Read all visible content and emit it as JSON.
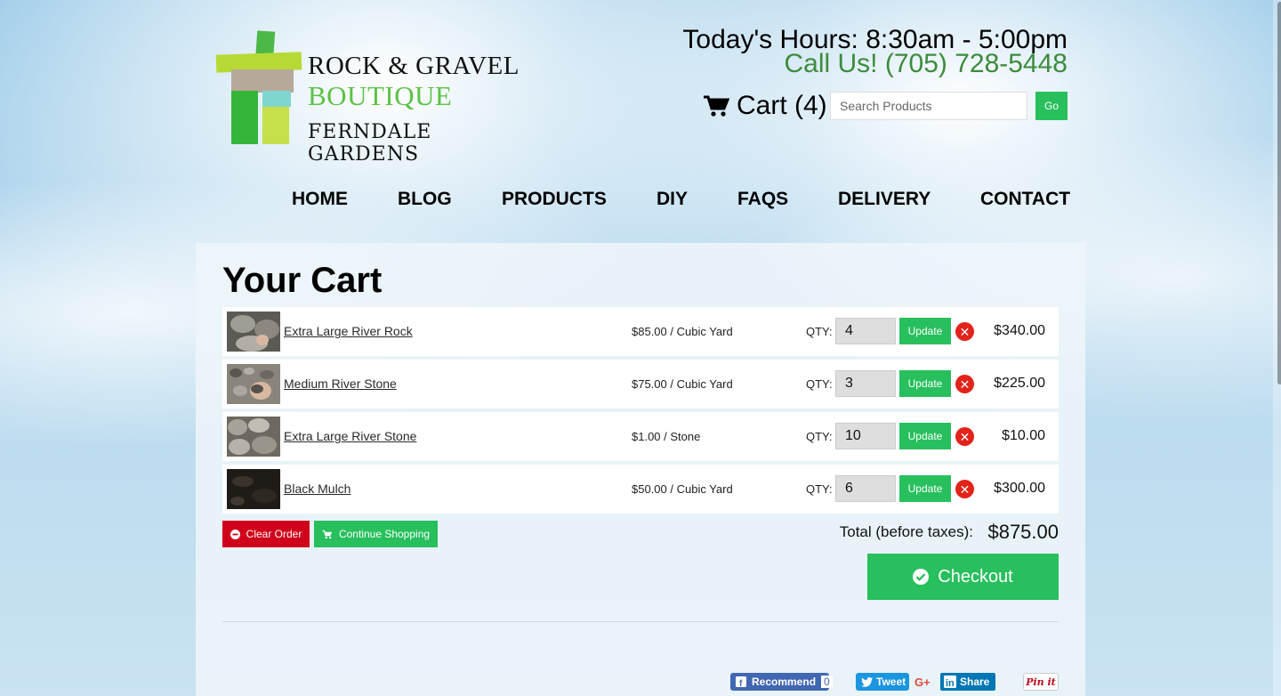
{
  "header": {
    "logo": {
      "line1": "ROCK & GRAVEL",
      "line2": "BOUTIQUE",
      "line3": "FERNDALE GARDENS"
    },
    "hours": "Today's Hours: 8:30am - 5:00pm",
    "phone": "Call Us! (705) 728-5448",
    "cart_label": "Cart (4)",
    "search_placeholder": "Search Products",
    "search_button": "Go"
  },
  "nav": [
    "HOME",
    "BLOG",
    "PRODUCTS",
    "DIY",
    "FAQS",
    "DELIVERY",
    "CONTACT"
  ],
  "cart": {
    "title": "Your Cart",
    "qty_label": "QTY:",
    "update_label": "Update",
    "items": [
      {
        "name": "Extra Large River Rock",
        "price": "$85.00 / Cubic Yard",
        "qty": "4",
        "total": "$340.00",
        "thumb_color": "#7d7a72"
      },
      {
        "name": "Medium River Stone",
        "price": "$75.00 / Cubic Yard",
        "qty": "3",
        "total": "$225.00",
        "thumb_color": "#6e6a62"
      },
      {
        "name": "Extra Large River Stone",
        "price": "$1.00 / Stone",
        "qty": "10",
        "total": "$10.00",
        "thumb_color": "#8b877f"
      },
      {
        "name": "Black Mulch",
        "price": "$50.00 / Cubic Yard",
        "qty": "6",
        "total": "$300.00",
        "thumb_color": "#2a2520"
      }
    ],
    "clear_label": "Clear Order",
    "continue_label": "Continue Shopping",
    "total_label": "Total (before taxes):",
    "total_value": "$875.00",
    "checkout_label": "Checkout"
  },
  "social": {
    "facebook_label": "Recommend",
    "facebook_count": "0",
    "twitter_label": "Tweet",
    "google_label": "G+",
    "linkedin_label": "Share",
    "pinterest_label": "Pin it"
  },
  "colors": {
    "accent_green": "#28bf5d",
    "danger_red": "#d0021b",
    "phone_green": "#3d8b3d",
    "logo_green": "#5cc245"
  }
}
